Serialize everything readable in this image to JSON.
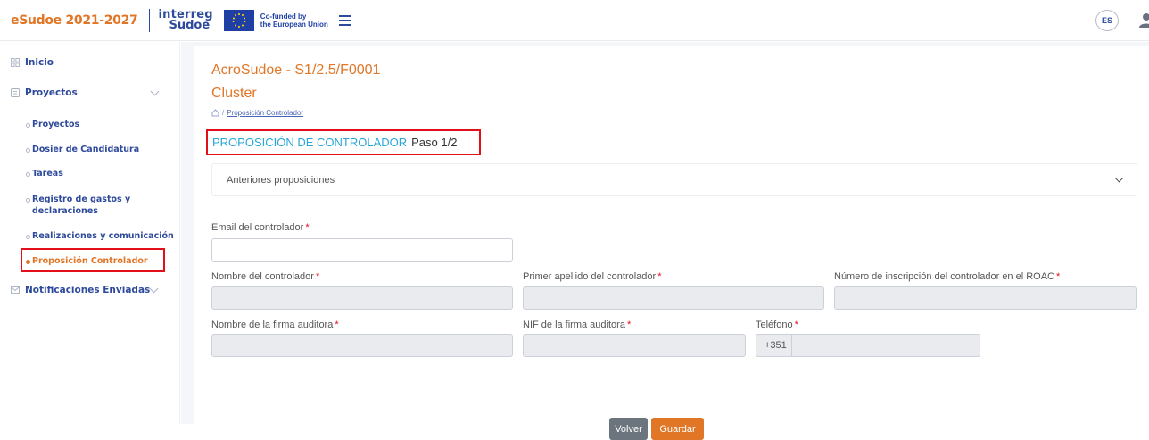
{
  "header": {
    "brand": "eSudoe 2021-2027",
    "interreg_line1": "interreg",
    "interreg_line2": "Sudoe",
    "cofunded_line1": "Co-funded by",
    "cofunded_line2": "the European Union",
    "language": "ES"
  },
  "sidebar": {
    "inicio": "Inicio",
    "proyectos": "Proyectos",
    "sub": [
      "Proyectos",
      "Dosier de Candidatura",
      "Tareas",
      "Registro de gastos y",
      "declaraciones",
      "Realizaciones y comunicación",
      "Proposición Controlador"
    ],
    "notificaciones": "Notificaciones Enviadas"
  },
  "page": {
    "title_line1": "AcroSudoe - S1/2.5/F0001",
    "title_line2": "Cluster",
    "breadcrumb_sep": "/",
    "breadcrumb_link": "Proposición Controlador",
    "step_title": "PROPOSICIÓN DE CONTROLADOR",
    "step_progress": "Paso 1/2",
    "accordion_label": "Anteriores proposiciones"
  },
  "form": {
    "email_label": "Email del controlador",
    "email_value": "",
    "nombre_label": "Nombre del controlador",
    "apellido_label": "Primer apellido del controlador",
    "roac_label": "Número de inscripción del controlador en el ROAC",
    "firma_label": "Nombre de la firma auditora",
    "nif_label": "NIF de la firma auditora",
    "telefono_label": "Teléfono",
    "phone_prefix": "+351",
    "required_mark": "*"
  },
  "actions": {
    "back": "Volver",
    "save": "Guardar"
  },
  "colors": {
    "accent_orange": "#e07626",
    "brand_blue": "#2e4a9c",
    "step_blue": "#29a7d8",
    "highlight_red": "#e3101b"
  }
}
